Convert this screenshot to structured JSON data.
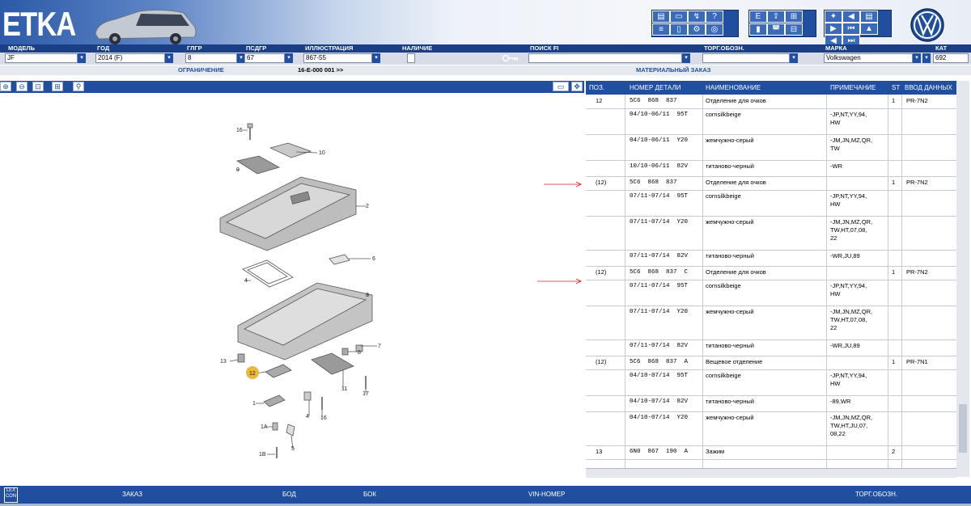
{
  "header": {
    "logo": "ETKA",
    "brand_emblem": "vw-logo"
  },
  "labels": {
    "model": "МОДЕЛЬ",
    "year": "ГОД",
    "main_group": "ГЛГР",
    "sub_group": "ПСДГР",
    "illustration": "ИЛЛЮСТРАЦИЯ",
    "availability": "НАЛИЧИЕ",
    "search": "ПОИСК FI",
    "trade_code": "ТОРГ.ОБОЗН.",
    "brand": "МАРКА",
    "catalog": "КАТ"
  },
  "fields": {
    "model": "JF",
    "year": "2014 (F)",
    "main_group": "8",
    "sub_group": "67",
    "illustration": "867-55",
    "brand": "Volkswagen",
    "catalog": "692"
  },
  "sub": {
    "restriction": "ОГРАНИЧЕНИЕ",
    "code": "16-E-000 001 >>",
    "material_order": "МАТЕРИАЛЬНЫЙ ЗАКАЗ"
  },
  "table": {
    "headers": [
      "ПОЗ.",
      "НОМЕР ДЕТАЛИ",
      "НАИМЕНОВАНИЕ",
      "ПРИМЕЧАНИЕ",
      "ST",
      "ВВОД ДАННЫХ"
    ],
    "rows": [
      {
        "pos": "12",
        "part": "5C6  868  837",
        "name": "Отделение для очков",
        "note": "",
        "st": "1",
        "input": "PR-7N2"
      },
      {
        "pos": "",
        "part": "04/10-06/11  95T",
        "name": "cornsilkbeige",
        "note": "-JP,NT,YY,94,\nHW",
        "st": "",
        "input": ""
      },
      {
        "pos": "",
        "part": "04/10-06/11  Y20",
        "name": "жемчужно-серый",
        "note": "-JM,JN,MZ,QR,\nTW",
        "st": "",
        "input": ""
      },
      {
        "pos": "",
        "part": "10/10-06/11  82V",
        "name": "титаново-черный",
        "note": "-WR",
        "st": "",
        "input": ""
      },
      {
        "pos": "(12)",
        "part": "5C6  868  837",
        "name": "Отделение для очков",
        "note": "",
        "st": "1",
        "input": "PR-7N2"
      },
      {
        "pos": "",
        "part": "07/11-07/14  95T",
        "name": "cornsilkbeige",
        "note": "-JP,NT,YY,94,\nHW",
        "st": "",
        "input": ""
      },
      {
        "pos": "",
        "part": "07/11-07/14  Y20",
        "name": "жемчужно-серый",
        "note": "-JM,JN,MZ,QR,\nTW,HT,07,08,\n22",
        "st": "",
        "input": ""
      },
      {
        "pos": "",
        "part": "07/11-07/14  82V",
        "name": "титаново-черный",
        "note": "-WR,JU,89",
        "st": "",
        "input": ""
      },
      {
        "pos": "(12)",
        "part": "5C6  868  837  C",
        "name": "Отделение для очков",
        "note": "",
        "st": "1",
        "input": "PR-7N2"
      },
      {
        "pos": "",
        "part": "07/11-07/14  95T",
        "name": "cornsilkbeige",
        "note": "-JP,NT,YY,94,\nHW",
        "st": "",
        "input": ""
      },
      {
        "pos": "",
        "part": "07/11-07/14  Y20",
        "name": "жемчужно-серый",
        "note": "-JM,JN,MZ,QR,\nTW,HT,07,08,\n22",
        "st": "",
        "input": ""
      },
      {
        "pos": "",
        "part": "07/11-07/14  82V",
        "name": "титаново-черный",
        "note": "-WR,JU,89",
        "st": "",
        "input": ""
      },
      {
        "pos": "(12)",
        "part": "5C6  868  837  A",
        "name": "Вещевое отделение",
        "note": "",
        "st": "1",
        "input": "PR-7N1"
      },
      {
        "pos": "",
        "part": "04/10-07/14  95T",
        "name": "cornsilkbeige",
        "note": "-JP,NT,YY,94,\nHW",
        "st": "",
        "input": ""
      },
      {
        "pos": "",
        "part": "04/10-07/14  82V",
        "name": "титаново-черный",
        "note": "-89,WR",
        "st": "",
        "input": ""
      },
      {
        "pos": "",
        "part": "04/10-07/14  Y20",
        "name": "жемчужно-серый",
        "note": "-JM,JN,MZ,QR,\nTW,HT,JU,07,\n08,22",
        "st": "",
        "input": ""
      },
      {
        "pos": "13",
        "part": "6N0  867  190  A",
        "name": "Зажим",
        "note": "",
        "st": "2",
        "input": ""
      }
    ]
  },
  "illustration_labels": [
    "16",
    "10",
    "9",
    "2",
    "6",
    "4",
    "3",
    "7",
    "8",
    "13",
    "12",
    "11",
    "17",
    "1",
    "4",
    "16",
    "1A",
    "5",
    "1B"
  ],
  "bottom": {
    "lex": "LEX\nCON",
    "order": "ЗАКАЗ",
    "bod": "БОД",
    "bok": "БОК",
    "vin": "VIN-НОМЕР",
    "trade": "ТОРГ.ОБОЗН."
  }
}
